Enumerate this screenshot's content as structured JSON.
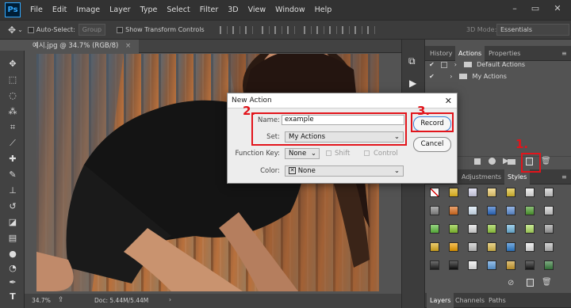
{
  "app": {
    "logo": "Ps"
  },
  "menu": [
    "File",
    "Edit",
    "Image",
    "Layer",
    "Type",
    "Select",
    "Filter",
    "3D",
    "View",
    "Window",
    "Help"
  ],
  "options": {
    "auto_select_label": "Auto-Select:",
    "auto_select_value": "Group",
    "show_transform_label": "Show Transform Controls",
    "mode_label": "3D Mode:",
    "workspace": "Essentials"
  },
  "document": {
    "tab_title": "예시.jpg @ 34.7% (RGB/8)"
  },
  "status": {
    "zoom": "34.7%",
    "doc_info": "Doc: 5.44M/5.44M"
  },
  "panel": {
    "top_tabs": [
      "History",
      "Actions",
      "Properties"
    ],
    "actions": [
      "Default Actions",
      "My Actions"
    ],
    "style_tabs": [
      "Adjustments",
      "Styles"
    ],
    "bottom_tabs": [
      "Layers",
      "Channels",
      "Paths"
    ]
  },
  "dialog": {
    "title": "New Action",
    "name_label": "Name:",
    "name_value": "example",
    "set_label": "Set:",
    "set_value": "My Actions",
    "function_key_label": "Function Key:",
    "function_key_value": "None",
    "shift_label": "Shift",
    "control_label": "Control",
    "color_label": "Color:",
    "color_value": "None",
    "record_button": "Record",
    "cancel_button": "Cancel"
  },
  "annotations": [
    "1.",
    "2.",
    "3."
  ],
  "colors": {
    "annotation_red": "#e2141b",
    "ps_blue": "#31a8ff"
  }
}
